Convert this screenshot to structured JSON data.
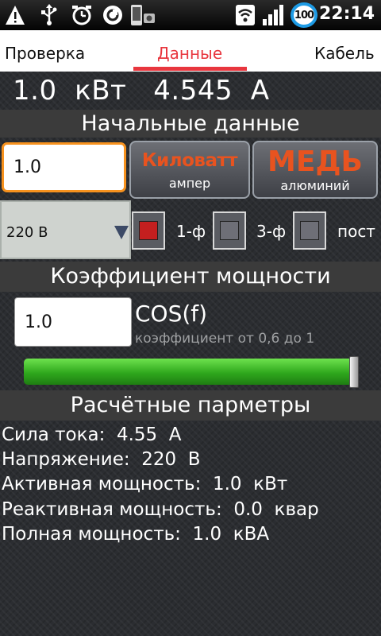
{
  "status_bar": {
    "icons": [
      "warning-icon",
      "usb-icon",
      "alarm-icon",
      "sync-icon",
      "screenshot-icon",
      "wifi-icon",
      "signal-icon"
    ],
    "battery": "100",
    "time": "22:14",
    "colors": {
      "battery_ring": "#1e9be5"
    }
  },
  "tabs": {
    "items": [
      "Проверка",
      "Данные",
      "Кабель"
    ],
    "active": "Данные",
    "colors": {
      "active": "#e8363e"
    }
  },
  "headline": "1.0  кВт   4.545  А",
  "initial_section": {
    "title": "Начальные данные",
    "power_input_value": "1.0",
    "unit_toggle": {
      "main": "Киловатт",
      "sub": "ампер"
    },
    "metal_toggle": {
      "main": "МЕДЬ",
      "sub": "алюминий"
    },
    "voltage_select": "220 В",
    "phase_options": [
      {
        "label": "1-ф",
        "checked": true
      },
      {
        "label": "3-ф",
        "checked": false
      },
      {
        "label": "пост",
        "checked": false
      }
    ],
    "colors": {
      "accent_orange": "#e8531f",
      "radio_on": "#c41f1f"
    }
  },
  "power_factor": {
    "title": "Коэффициент мощности",
    "input_value": "1.0",
    "label": "COS(f)",
    "hint": "коэффициент от 0,6 до 1",
    "progress": 1.0
  },
  "results": {
    "title": "Расчётные парметры",
    "lines": [
      "Сила тока:  4.55  А",
      "Напряжение:  220  В",
      "Активная мощность:  1.0  кВт",
      "Реактивная мощность:  0.0  квар",
      "Полная мощность:  1.0  кВА"
    ]
  }
}
